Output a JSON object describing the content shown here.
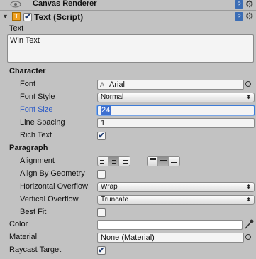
{
  "canvas_renderer": {
    "title": "Canvas Renderer"
  },
  "text_component": {
    "title": "Text (Script)",
    "enabled": true
  },
  "text": {
    "label": "Text",
    "value": "Win Text"
  },
  "character": {
    "header": "Character",
    "font": {
      "label": "Font",
      "value": "Arial"
    },
    "font_style": {
      "label": "Font Style",
      "value": "Normal"
    },
    "font_size": {
      "label": "Font Size",
      "value": "24"
    },
    "line_spacing": {
      "label": "Line Spacing",
      "value": "1"
    },
    "rich_text": {
      "label": "Rich Text",
      "checked": true
    }
  },
  "paragraph": {
    "header": "Paragraph",
    "alignment": {
      "label": "Alignment",
      "horizontal_selected": "center",
      "vertical_selected": "middle"
    },
    "align_by_geometry": {
      "label": "Align By Geometry",
      "checked": false
    },
    "horizontal_overflow": {
      "label": "Horizontal Overflow",
      "value": "Wrap"
    },
    "vertical_overflow": {
      "label": "Vertical Overflow",
      "value": "Truncate"
    },
    "best_fit": {
      "label": "Best Fit",
      "checked": false
    }
  },
  "color": {
    "label": "Color",
    "value": "#ffffff"
  },
  "material": {
    "label": "Material",
    "value": "None (Material)"
  },
  "raycast_target": {
    "label": "Raycast Target",
    "checked": true
  },
  "colors": {
    "focus_label": "#2d5bc6",
    "background": "#c2c2c2"
  }
}
